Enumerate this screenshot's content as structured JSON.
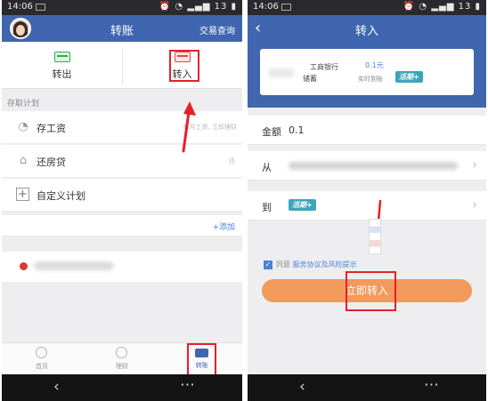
{
  "left_screen": {
    "status": {
      "time": "14:06",
      "signal": "13"
    },
    "nav": {
      "title": "转账",
      "right_link": "交易查询"
    },
    "tabs": {
      "out_label": "转出",
      "in_label": "转入"
    },
    "section_title": "存取计划",
    "plans": [
      {
        "label": "存工资",
        "note": "每月工资, 立即理财",
        "icon": "piggy-bank-icon"
      },
      {
        "label": "还房贷",
        "note": "还",
        "icon": "house-icon"
      },
      {
        "label": "自定义计划",
        "note": "",
        "icon": "plus-icon"
      }
    ],
    "add_label": "+添加",
    "tabbar": [
      {
        "label": "首页",
        "icon": "clock-icon"
      },
      {
        "label": "理财",
        "icon": "person-icon"
      },
      {
        "label": "转账",
        "icon": "card-icon"
      }
    ]
  },
  "right_screen": {
    "status": {
      "time": "14:06",
      "signal": "13"
    },
    "nav": {
      "title": "转入"
    },
    "account_card": {
      "bank_name": "工商银行",
      "card_type": "储蓄",
      "amount": "0.1元",
      "arrival": "实时到账",
      "badge": "活期+"
    },
    "form": {
      "amount_label": "金额",
      "amount_value": "0.1",
      "from_label": "从",
      "to_label": "到",
      "to_badge": "活期+"
    },
    "agreement": {
      "prefix": "同意",
      "link_text": "服务协议及风险提示"
    },
    "submit_label": "立即转入"
  },
  "colors": {
    "brand_blue": "#4166b0",
    "highlight_red": "#e5202a",
    "cta_orange": "#f29a5c",
    "link_blue": "#4a82d8"
  }
}
